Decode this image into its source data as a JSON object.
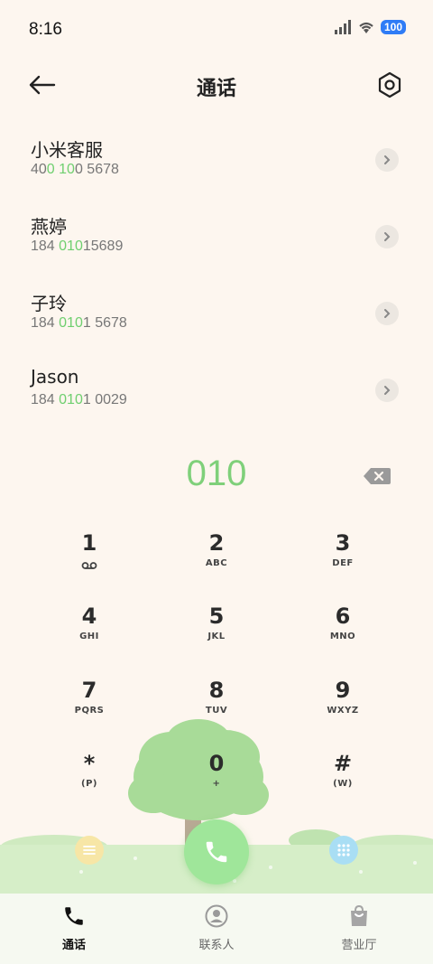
{
  "status": {
    "time": "8:16",
    "battery": "100"
  },
  "header": {
    "title": "通话"
  },
  "results": [
    {
      "name": "小米客服",
      "number_parts": [
        [
          "40",
          false
        ],
        [
          "0",
          true
        ],
        [
          " ",
          false
        ],
        [
          "10",
          true
        ],
        [
          "0 5678",
          false
        ]
      ]
    },
    {
      "name": "燕婷",
      "number_parts": [
        [
          "184 ",
          false
        ],
        [
          "010",
          true
        ],
        [
          "15689",
          false
        ]
      ]
    },
    {
      "name": "子玲",
      "number_parts": [
        [
          "184 ",
          false
        ],
        [
          "010",
          true
        ],
        [
          "1 5678",
          false
        ]
      ]
    },
    {
      "name": "Jason",
      "number_parts": [
        [
          "184 ",
          false
        ],
        [
          "010",
          true
        ],
        [
          "1 0029",
          false
        ]
      ]
    }
  ],
  "dial": {
    "input": "010"
  },
  "keypad": [
    {
      "digit": "1",
      "letters": "",
      "icon": "voicemail-icon"
    },
    {
      "digit": "2",
      "letters": "ABC"
    },
    {
      "digit": "3",
      "letters": "DEF"
    },
    {
      "digit": "4",
      "letters": "GHI"
    },
    {
      "digit": "5",
      "letters": "JKL"
    },
    {
      "digit": "6",
      "letters": "MNO"
    },
    {
      "digit": "7",
      "letters": "PQRS"
    },
    {
      "digit": "8",
      "letters": "TUV"
    },
    {
      "digit": "9",
      "letters": "WXYZ"
    },
    {
      "digit": "*",
      "letters": "(P)"
    },
    {
      "digit": "0",
      "letters": "+"
    },
    {
      "digit": "#",
      "letters": "(W)"
    }
  ],
  "nav": {
    "calls": "通话",
    "contacts": "联系人",
    "hall": "营业厅"
  },
  "colors": {
    "accent_green": "#7fd07a",
    "call_button": "#9fe69a",
    "battery": "#2f7cf6"
  }
}
